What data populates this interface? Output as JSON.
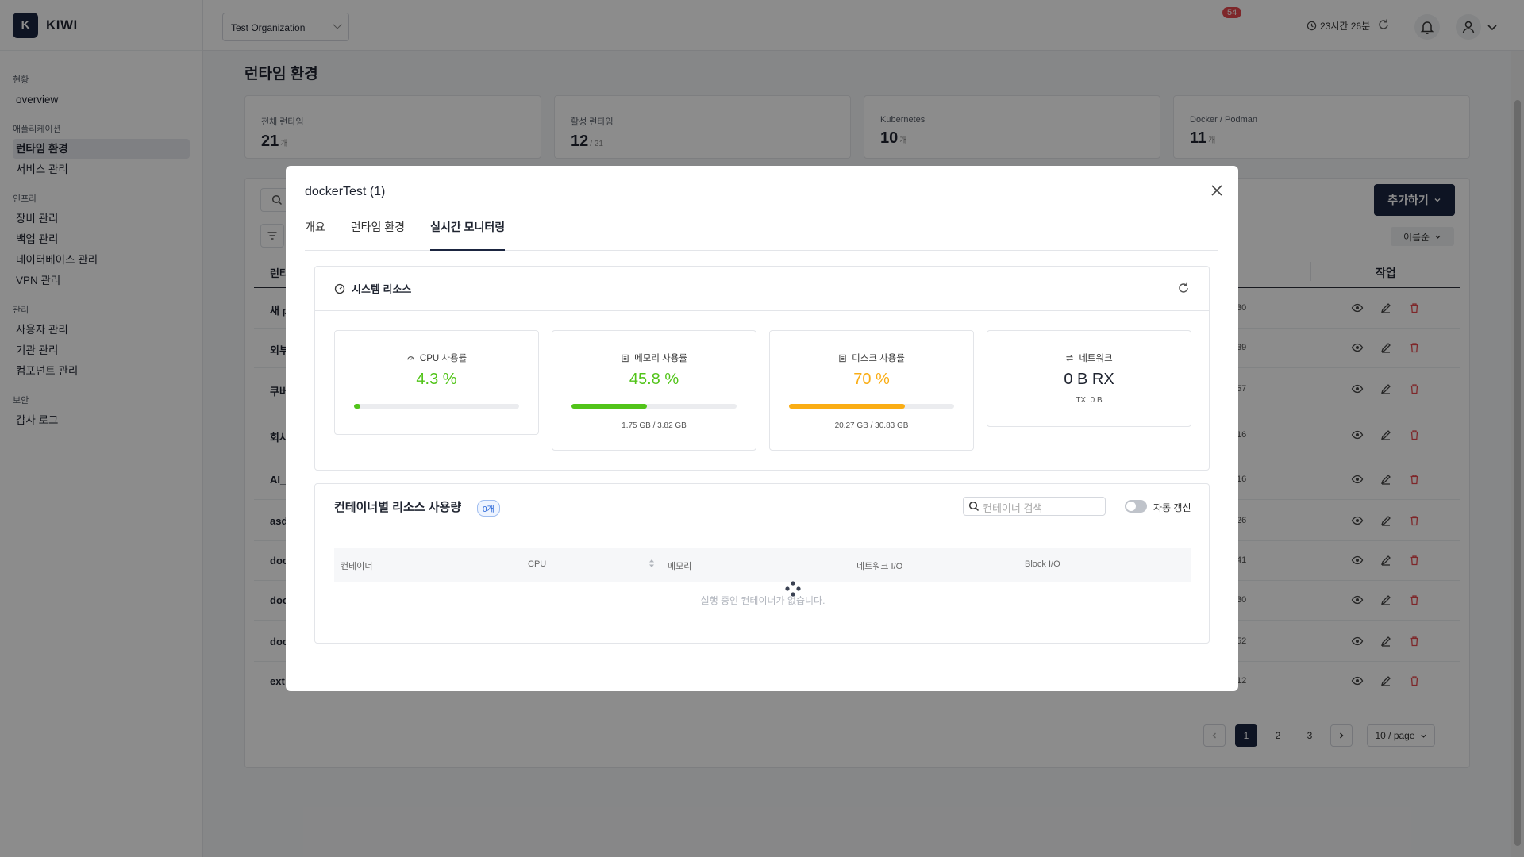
{
  "brand": {
    "logo_letter": "K",
    "name": "KIWI"
  },
  "sidebar": {
    "sections": [
      {
        "title": "현황",
        "items": [
          {
            "label": "overview"
          }
        ]
      },
      {
        "title": "애플리케이션",
        "items": [
          {
            "label": "런타임 환경",
            "active": true
          },
          {
            "label": "서비스 관리"
          }
        ]
      },
      {
        "title": "인프라",
        "items": [
          {
            "label": "장비 관리"
          },
          {
            "label": "백업 관리"
          },
          {
            "label": "데이터베이스 관리"
          },
          {
            "label": "VPN 관리"
          }
        ]
      },
      {
        "title": "관리",
        "items": [
          {
            "label": "사용자 관리"
          },
          {
            "label": "기관 관리"
          },
          {
            "label": "컴포넌트 관리"
          }
        ]
      },
      {
        "title": "보안",
        "items": [
          {
            "label": "감사 로그"
          }
        ]
      }
    ]
  },
  "header": {
    "org_select": "Test Organization",
    "session_timer": "23시간 26분",
    "notification_count": "54"
  },
  "main": {
    "title": "런타임 환경",
    "stats": [
      {
        "label": "전체 런타임",
        "value": "21",
        "unit": "개"
      },
      {
        "label": "활성 런타임",
        "value": "12",
        "unit": "/ 21"
      },
      {
        "label": "Kubernetes",
        "value": "10",
        "unit": "개"
      },
      {
        "label": "Docker / Podman",
        "value": "11",
        "unit": "개"
      }
    ],
    "add_button": "추가하기",
    "sort_select": "이름순",
    "col_name_fragment": "런타",
    "col_action": "작업",
    "rows": [
      {
        "name": "새 p",
        "num": "30"
      },
      {
        "name": "외부",
        "num": "39"
      },
      {
        "name": "쿠버",
        "num": "57"
      },
      {
        "name": "회사",
        "num": "16"
      },
      {
        "name": "AI_",
        "num": "16"
      },
      {
        "name": "asd",
        "num": "26"
      },
      {
        "name": "doc",
        "num": "41"
      },
      {
        "name": "doc",
        "num": "30"
      },
      {
        "name": "doc",
        "num": "52"
      },
      {
        "name": "ext",
        "num": "12"
      }
    ],
    "pagination": {
      "pages": [
        "1",
        "2",
        "3"
      ],
      "current": "1",
      "page_size": "10 / page"
    }
  },
  "modal": {
    "title": "dockerTest (1)",
    "tabs": [
      {
        "label": "개요"
      },
      {
        "label": "런타임 환경"
      },
      {
        "label": "실시간 모니터링",
        "active": true
      }
    ],
    "system_resources": {
      "title": "시스템 리소스",
      "metrics": [
        {
          "label": "CPU 사용률",
          "value": "4.3 %",
          "fill": 0.043,
          "color": "#52c41a",
          "sub": ""
        },
        {
          "label": "메모리 사용률",
          "value": "45.8 %",
          "fill": 0.458,
          "color": "#52c41a",
          "sub": "1.75 GB / 3.82 GB"
        },
        {
          "label": "디스크 사용률",
          "value": "70 %",
          "fill": 0.7,
          "color": "#faad14",
          "sub": "20.27 GB / 30.83 GB"
        },
        {
          "label": "네트워크",
          "value": "0 B RX",
          "color": "#1f2430",
          "sub": "TX: 0 B"
        }
      ]
    },
    "containers": {
      "title": "컨테이너별 리소스 사용량",
      "badge": "0개",
      "search_placeholder": "컨테이너 검색",
      "auto_refresh_label": "자동 갱신",
      "columns": [
        "컨테이너",
        "CPU",
        "메모리",
        "네트워크 I/O",
        "Block I/O"
      ],
      "empty_message": "실행 중인 컨테이너가 없습니다."
    }
  },
  "colors": {
    "primary": "#1b2540",
    "success": "#52c41a",
    "warning": "#faad14",
    "danger": "#e5484d"
  }
}
